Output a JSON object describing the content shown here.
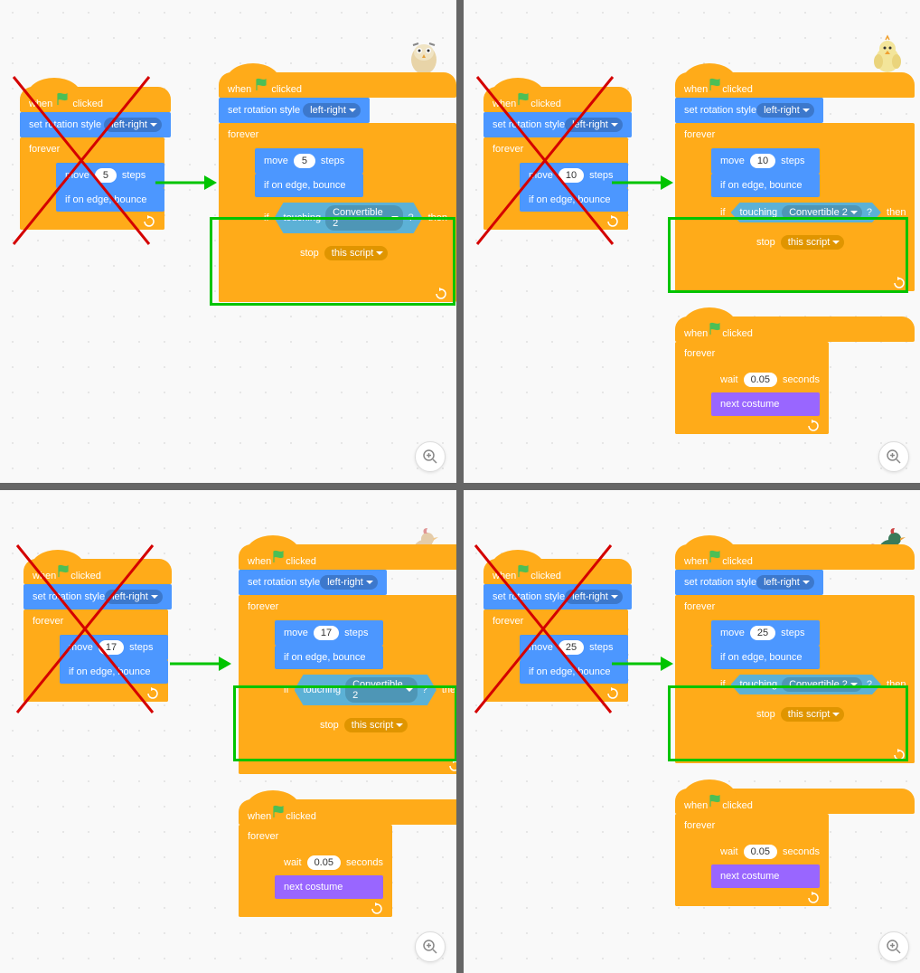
{
  "common": {
    "when_clicked": "when",
    "clicked_suffix": "clicked",
    "set_rotation": "set rotation style",
    "left_right": "left-right",
    "forever": "forever",
    "move_prefix": "move",
    "move_suffix": "steps",
    "bounce": "if on edge, bounce",
    "if_word": "if",
    "then_word": "then",
    "touching": "touching",
    "touching_target": "Convertible 2",
    "touching_q": "?",
    "stop": "stop",
    "stop_target": "this script",
    "wait_prefix": "wait",
    "wait_val": "0.05",
    "wait_suffix": "seconds",
    "next_costume": "next costume"
  },
  "panels": [
    {
      "id": "tl",
      "sprite": "owl",
      "move_steps": "5",
      "has_costume_loop": false
    },
    {
      "id": "tr",
      "sprite": "chick",
      "move_steps": "10",
      "has_costume_loop": true
    },
    {
      "id": "bl",
      "sprite": "rooster1",
      "move_steps": "17",
      "has_costume_loop": true
    },
    {
      "id": "br",
      "sprite": "rooster2",
      "move_steps": "25",
      "has_costume_loop": true
    }
  ]
}
